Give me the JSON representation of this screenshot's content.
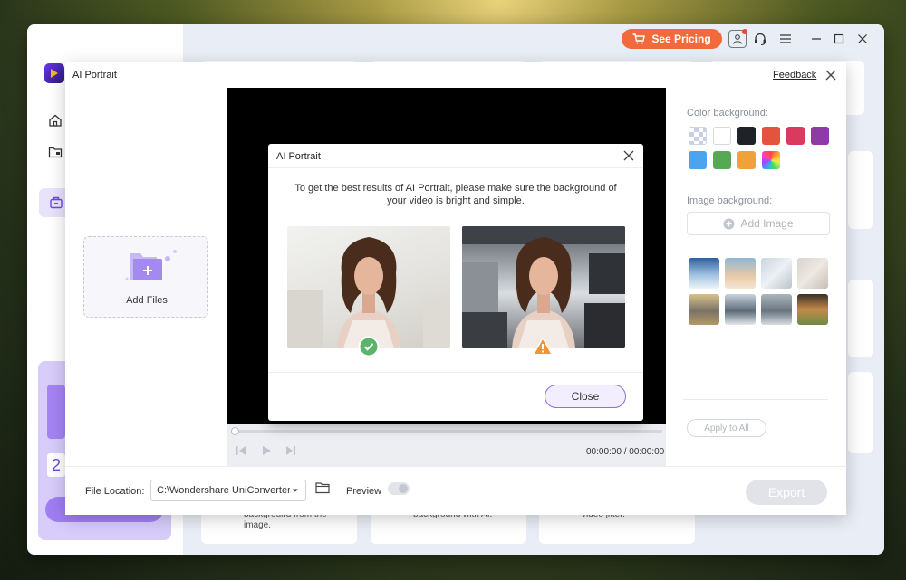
{
  "app": {
    "pricing_label": "See Pricing",
    "sidebar": {
      "nav_icons": [
        "home-icon",
        "folder-icon",
        "toolbox-icon"
      ],
      "promo_number": "2"
    },
    "cards": {
      "card1_text": "background from the image.",
      "card2_text": "background with AI.",
      "card3_text": "video jitter."
    }
  },
  "panel": {
    "title": "AI Portrait",
    "feedback_label": "Feedback",
    "add_files_label": "Add Files",
    "video": {
      "current_time": "00:00:00",
      "separator": "/",
      "total_time": "00:00:00",
      "progress": 0
    },
    "color_background_label": "Color background:",
    "swatches": [
      "transparent",
      "#ffffff",
      "#1f2226",
      "#e4533d",
      "#d93a5f",
      "#8e3aa7",
      "#4da3ec",
      "#55a854",
      "#f0a13a",
      "gradient"
    ],
    "image_background_label": "Image background:",
    "add_image_label": "Add Image",
    "image_thumbs": [
      [
        "#2b5fa0",
        "#9fc2e2",
        "#eef3f7"
      ],
      [
        "#8fb7d3",
        "#e9c9a8",
        "#f4e6d3"
      ],
      [
        "#c8d4de",
        "#eef1f4",
        "#b9c3cb"
      ],
      [
        "#d9d4cd",
        "#ece8e2",
        "#c8bfb5"
      ],
      [
        "#d8c08a",
        "#7a7366",
        "#b39868"
      ],
      [
        "#c7d3dd",
        "#5c6b78",
        "#e4e8ec"
      ],
      [
        "#aab5bc",
        "#6a7580",
        "#d7dcdf"
      ],
      [
        "#3a2f26",
        "#c48a4a",
        "#6b8a45"
      ]
    ],
    "apply_all_label": "Apply to All",
    "footer": {
      "file_location_label": "File Location:",
      "file_location_value": "C:\\Wondershare UniConverter 1",
      "preview_label": "Preview",
      "preview_on": false,
      "export_label": "Export"
    }
  },
  "dialog": {
    "title": "AI Portrait",
    "message": "To get the best results of AI Portrait, please make sure the background of your video is bright and simple.",
    "good_example_badge": "check-icon",
    "bad_example_badge": "warning-icon",
    "close_label": "Close"
  }
}
